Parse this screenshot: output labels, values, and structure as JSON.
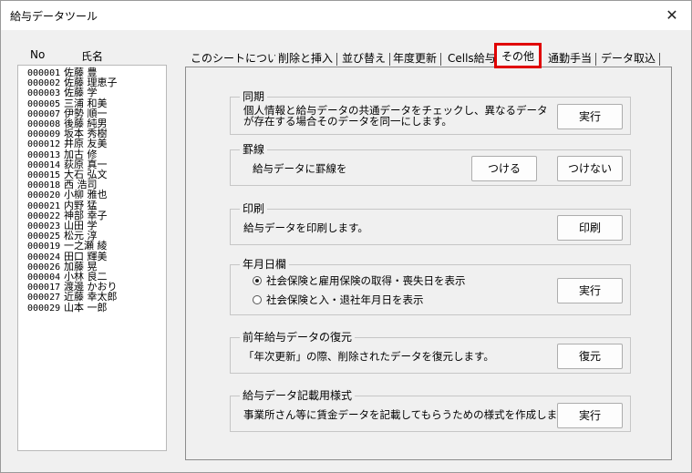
{
  "window": {
    "title": "給与データツール",
    "close_glyph": "✕"
  },
  "list": {
    "headers": {
      "no": "No",
      "name": "氏名"
    },
    "items": [
      {
        "no": "000001",
        "name": "佐藤 豊"
      },
      {
        "no": "000002",
        "name": "佐藤 理恵子"
      },
      {
        "no": "000003",
        "name": "佐藤 学"
      },
      {
        "no": "000005",
        "name": "三浦 和美"
      },
      {
        "no": "000007",
        "name": "伊勢 順一"
      },
      {
        "no": "000008",
        "name": "後藤 純男"
      },
      {
        "no": "000009",
        "name": "坂本 秀樹"
      },
      {
        "no": "000012",
        "name": "井原 友美"
      },
      {
        "no": "000013",
        "name": "加古 修"
      },
      {
        "no": "000014",
        "name": "荻原 真一"
      },
      {
        "no": "000015",
        "name": "大石 弘文"
      },
      {
        "no": "000018",
        "name": "西 浩司"
      },
      {
        "no": "000020",
        "name": "小柳 雅也"
      },
      {
        "no": "000021",
        "name": "内野 猛"
      },
      {
        "no": "000022",
        "name": "神部 幸子"
      },
      {
        "no": "000023",
        "name": "山田 学"
      },
      {
        "no": "000025",
        "name": "松元 淳"
      },
      {
        "no": "000019",
        "name": "一之瀬 綾"
      },
      {
        "no": "000024",
        "name": "田口 輝美"
      },
      {
        "no": "000026",
        "name": "加藤 晃"
      },
      {
        "no": "000004",
        "name": "小林 良二"
      },
      {
        "no": "000017",
        "name": "渡邊 かおり"
      },
      {
        "no": "000027",
        "name": "近藤 幸太郎"
      },
      {
        "no": "000029",
        "name": "山本 一郎"
      }
    ]
  },
  "tabs": [
    {
      "label": "このシートについて"
    },
    {
      "label": "削除と挿入"
    },
    {
      "label": "並び替え"
    },
    {
      "label": "年度更新"
    },
    {
      "label": "Cells給与"
    },
    {
      "label": "その他"
    },
    {
      "label": "通勤手当"
    },
    {
      "label": "データ取込"
    }
  ],
  "active_tab": "その他",
  "colors": {
    "highlight": "#e00000"
  },
  "groups": {
    "sync": {
      "title": "同期",
      "desc_line1": "個人情報と給与データの共通データをチェックし、異なるデータ",
      "desc_line2": "が存在する場合そのデータを同一にします。",
      "button": "実行"
    },
    "border": {
      "title": "罫線",
      "desc": "給与データに罫線を",
      "button_on": "つける",
      "button_off": "つけない"
    },
    "print": {
      "title": "印刷",
      "desc": "給与データを印刷します。",
      "button": "印刷"
    },
    "date": {
      "title": "年月日欄",
      "option1": "社会保険と雇用保険の取得・喪失日を表示",
      "option2": "社会保険と入・退社年月日を表示",
      "selected": 1,
      "button": "実行"
    },
    "restore": {
      "title": "前年給与データの復元",
      "desc": "「年次更新」の際、削除されたデータを復元します。",
      "button": "復元"
    },
    "form": {
      "title": "給与データ記載用様式",
      "desc": "事業所さん等に賃金データを記載してもらうための様式を作成します。",
      "button": "実行"
    }
  }
}
